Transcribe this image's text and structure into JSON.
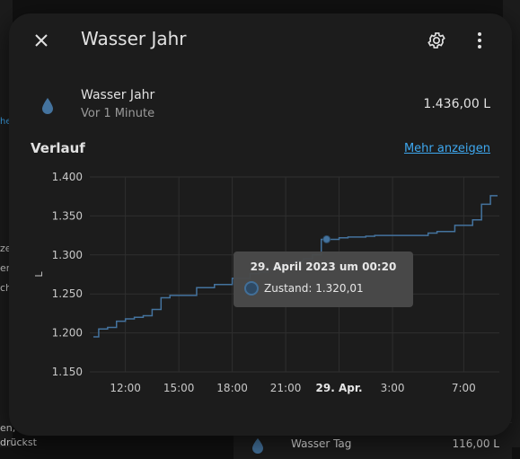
{
  "background": {
    "fragments": [
      "he",
      "ze",
      "en",
      "ch",
      "en,",
      "drückst",
      "Wasser Tag",
      "116,00 L"
    ]
  },
  "dialog": {
    "title": "Wasser Jahr",
    "icons": {
      "close": "close-icon",
      "settings": "gear-icon",
      "more": "dots-vertical-icon"
    }
  },
  "entity": {
    "icon": "water-drop-icon",
    "name": "Wasser Jahr",
    "last_changed": "Vor 1 Minute",
    "state": "1.436,00 L"
  },
  "history": {
    "section_title": "Verlauf",
    "more_link": "Mehr anzeigen"
  },
  "chart_data": {
    "type": "line",
    "ylabel": "L",
    "y_ticks": [
      "1.400",
      "1.350",
      "1.300",
      "1.250",
      "1.200",
      "1.150"
    ],
    "ylim": [
      1150,
      1400
    ],
    "x_ticks": [
      "12:00",
      "15:00",
      "18:00",
      "21:00",
      "29. Apr.",
      "3:00",
      "7:00"
    ],
    "series": [
      {
        "x_hours": [
          10.2,
          10.5,
          11.0,
          11.5,
          12.0,
          12.5,
          13.0,
          13.5,
          14.0,
          14.5,
          15.0,
          15.5,
          16.0,
          16.5,
          17.0,
          17.5,
          18.0,
          18.5,
          19.0,
          19.5,
          20.0,
          20.5,
          21.0,
          21.5,
          22.0,
          22.5,
          23.0,
          23.5,
          24.0,
          24.5,
          25.0,
          25.5,
          26.0,
          26.5,
          27.0,
          27.5,
          28.0,
          28.5,
          29.0,
          29.5,
          30.0,
          30.5,
          31.0,
          31.5,
          32.0,
          32.5,
          32.9
        ],
        "values": [
          1195,
          1205,
          1207,
          1215,
          1218,
          1220,
          1222,
          1230,
          1245,
          1248,
          1248,
          1248,
          1258,
          1258,
          1262,
          1262,
          1270,
          1270,
          1276,
          1278,
          1282,
          1285,
          1290,
          1292,
          1295,
          1300,
          1320,
          1320,
          1322,
          1323,
          1323,
          1324,
          1325,
          1325,
          1325,
          1325,
          1325,
          1325,
          1328,
          1330,
          1330,
          1338,
          1338,
          1345,
          1365,
          1376,
          1376
        ]
      }
    ],
    "highlight_point": {
      "x_hour": 23.3,
      "value": 1320.01
    },
    "colors": {
      "line": "#44739e",
      "grid": "#2f2f2f"
    }
  },
  "tooltip": {
    "title": "29. April 2023 um 00:20",
    "label": "Zustand: 1.320,01"
  }
}
